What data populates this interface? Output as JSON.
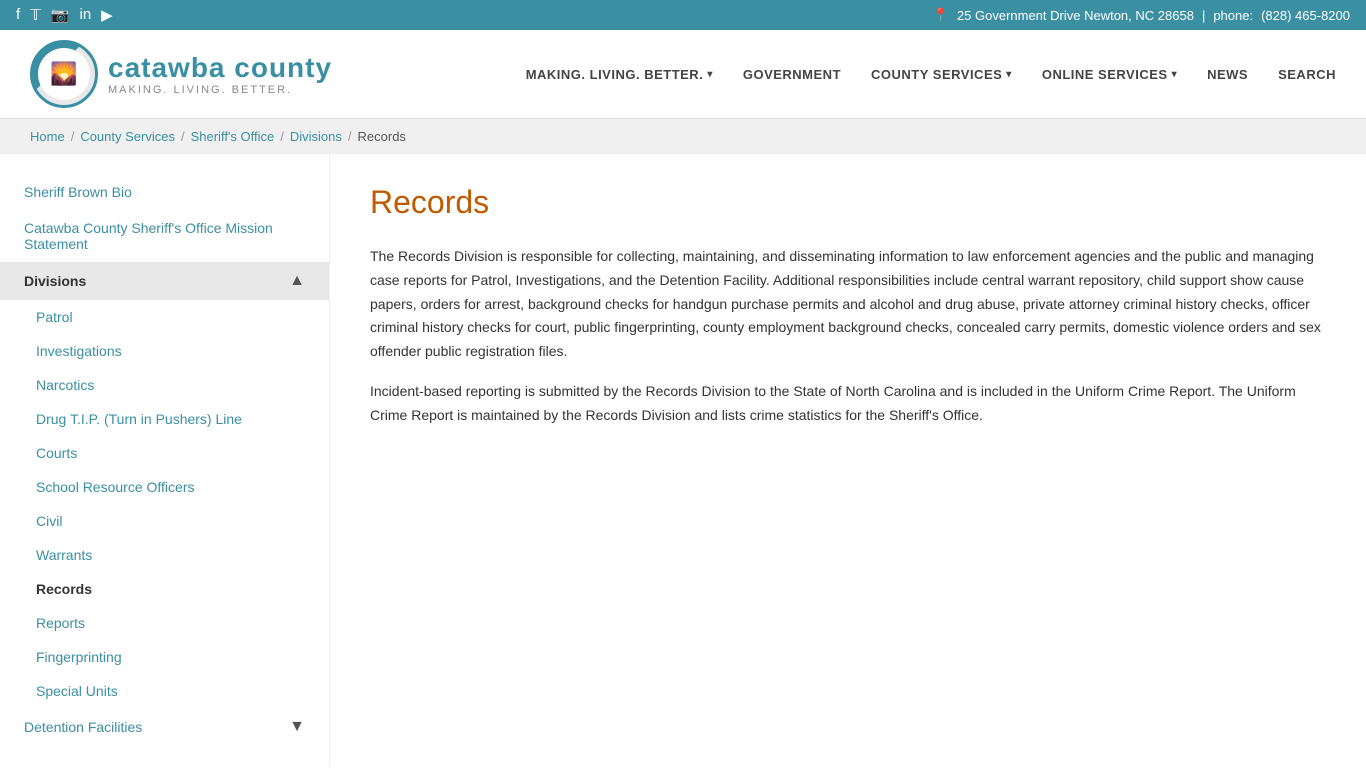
{
  "topbar": {
    "address": "25 Government Drive Newton, NC 28658",
    "separator": "|",
    "phone_label": "phone:",
    "phone": "(828) 465-8200",
    "social_icons": [
      "𝐟",
      "🐦",
      "📷",
      "in",
      "▶"
    ]
  },
  "header": {
    "logo_icon": "🌅",
    "site_name": "catawba county",
    "tagline": "MAKING. LIVING. BETTER.",
    "nav": [
      {
        "label": "MAKING. LIVING. BETTER.",
        "has_caret": true
      },
      {
        "label": "GOVERNMENT",
        "has_caret": false
      },
      {
        "label": "COUNTY SERVICES",
        "has_caret": true
      },
      {
        "label": "ONLINE SERVICES",
        "has_caret": true
      },
      {
        "label": "NEWS",
        "has_caret": false
      },
      {
        "label": "SEARCH",
        "has_caret": false
      }
    ]
  },
  "breadcrumb": {
    "items": [
      "Home",
      "County Services",
      "Sheriff's Office",
      "Divisions",
      "Records"
    ]
  },
  "sidebar": {
    "top_links": [
      {
        "label": "Sheriff Brown Bio"
      },
      {
        "label": "Catawba County Sheriff's Office Mission Statement"
      }
    ],
    "divisions_label": "Divisions",
    "divisions_caret": "▲",
    "sub_links": [
      {
        "label": "Patrol",
        "active": false
      },
      {
        "label": "Investigations",
        "active": false
      },
      {
        "label": "Narcotics",
        "active": false
      },
      {
        "label": "Drug T.I.P. (Turn in Pushers) Line",
        "active": false
      },
      {
        "label": "Courts",
        "active": false
      },
      {
        "label": "School Resource Officers",
        "active": false
      },
      {
        "label": "Civil",
        "active": false
      },
      {
        "label": "Warrants",
        "active": false
      },
      {
        "label": "Records",
        "active": true
      },
      {
        "label": "Reports",
        "active": false
      },
      {
        "label": "Fingerprinting",
        "active": false
      },
      {
        "label": "Special Units",
        "active": false
      }
    ],
    "detention_label": "Detention Facilities",
    "detention_caret": "▼"
  },
  "main": {
    "title": "Records",
    "paragraph1": "The Records Division is responsible for collecting, maintaining, and disseminating information to law enforcement agencies and the public and managing case reports for Patrol, Investigations, and the Detention Facility. Additional responsibilities include central warrant repository, child support show cause papers, orders for arrest, background checks for handgun purchase permits and alcohol and drug abuse, private attorney criminal history checks, officer criminal history checks for court, public fingerprinting, county employment background checks, concealed carry permits, domestic violence orders and sex offender public registration files.",
    "paragraph2": "Incident-based reporting is submitted by the Records Division to the State of North Carolina and is included in the Uniform Crime Report. The Uniform Crime Report is maintained by the Records Division and lists crime statistics for the Sheriff's Office."
  }
}
